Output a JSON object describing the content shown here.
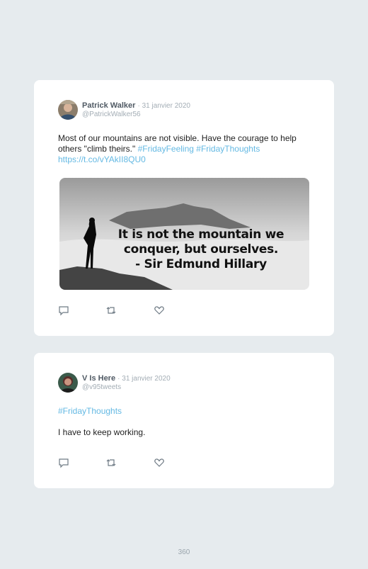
{
  "tweets": [
    {
      "author": "Patrick Walker",
      "date": "· 31 janvier 2020",
      "handle": "@PatrickWalker56",
      "text_plain": "Most of our mountains are not visible. Have the courage to help others \"climb theirs.\"",
      "hashtags": "#FridayFeeling #FridayThoughts",
      "url": "https://t.co/vYAkII8QU0",
      "image_quote": {
        "line1": "It is not the mountain we",
        "line2": "conquer, but ourselves.",
        "line3": "-  Sir Edmund Hillary"
      }
    },
    {
      "author": "V Is Here",
      "date": "· 31 janvier 2020",
      "handle": "@v95tweets",
      "hashtag": "#FridayThoughts",
      "text": "I have to keep working."
    }
  ],
  "page_number": "360",
  "colors": {
    "link": "#64b9e3",
    "background": "#e6ebee",
    "card": "#ffffff"
  },
  "icons": [
    "reply-icon",
    "retweet-icon",
    "like-icon"
  ]
}
